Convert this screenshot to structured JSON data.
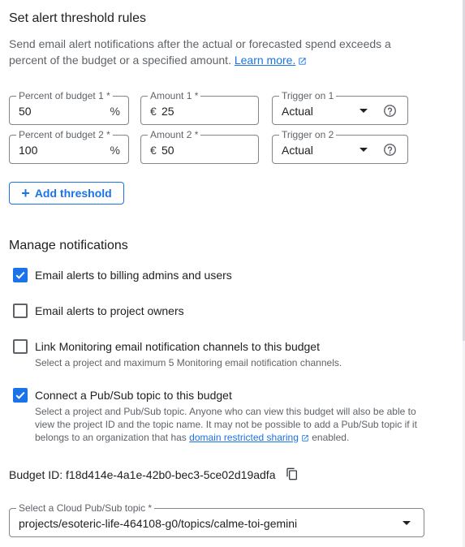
{
  "threshold_section": {
    "title": "Set alert threshold rules",
    "description": "Send email alert notifications after the actual or forecasted spend exceeds a percent of the budget or a specified amount.",
    "learn_more": "Learn more."
  },
  "thresholds": [
    {
      "percent_label": "Percent of budget 1 *",
      "percent_value": "50",
      "percent_suffix": "%",
      "amount_label": "Amount 1 *",
      "currency": "€",
      "amount_value": "25",
      "trigger_label": "Trigger on 1",
      "trigger_value": "Actual"
    },
    {
      "percent_label": "Percent of budget 2 *",
      "percent_value": "100",
      "percent_suffix": "%",
      "amount_label": "Amount 2 *",
      "currency": "€",
      "amount_value": "50",
      "trigger_label": "Trigger on 2",
      "trigger_value": "Actual"
    }
  ],
  "add_threshold": {
    "label": "Add threshold"
  },
  "notifications": {
    "title": "Manage notifications",
    "items": [
      {
        "label": "Email alerts to billing admins and users",
        "checked": true
      },
      {
        "label": "Email alerts to project owners",
        "checked": false
      },
      {
        "label": "Link Monitoring email notification channels to this budget",
        "checked": false,
        "help": "Select a project and maximum 5 Monitoring email notification channels."
      },
      {
        "label": "Connect a Pub/Sub topic to this budget",
        "checked": true,
        "help_pre": "Select a project and Pub/Sub topic. Anyone who can view this budget will also be able to view the project ID and the topic name. It may not be possible to add a Pub/Sub topic if it belongs to an organization that has",
        "help_link": "domain restricted sharing",
        "help_post": "enabled."
      }
    ]
  },
  "budget_id": {
    "text": "Budget ID: f18d414e-4a1e-42b0-bec3-5ce02d19adfa"
  },
  "pubsub": {
    "label": "Select a Cloud Pub/Sub topic *",
    "value": "projects/esoteric-life-464108-g0/topics/calme-toi-gemini"
  },
  "colors": {
    "accent": "#1a73e8",
    "text": "#202124",
    "secondary": "#5f6368",
    "border": "#80868b"
  },
  "icons": [
    "external-link-icon",
    "help-icon",
    "dropdown-arrow-icon",
    "plus-icon",
    "check-icon",
    "copy-icon"
  ]
}
